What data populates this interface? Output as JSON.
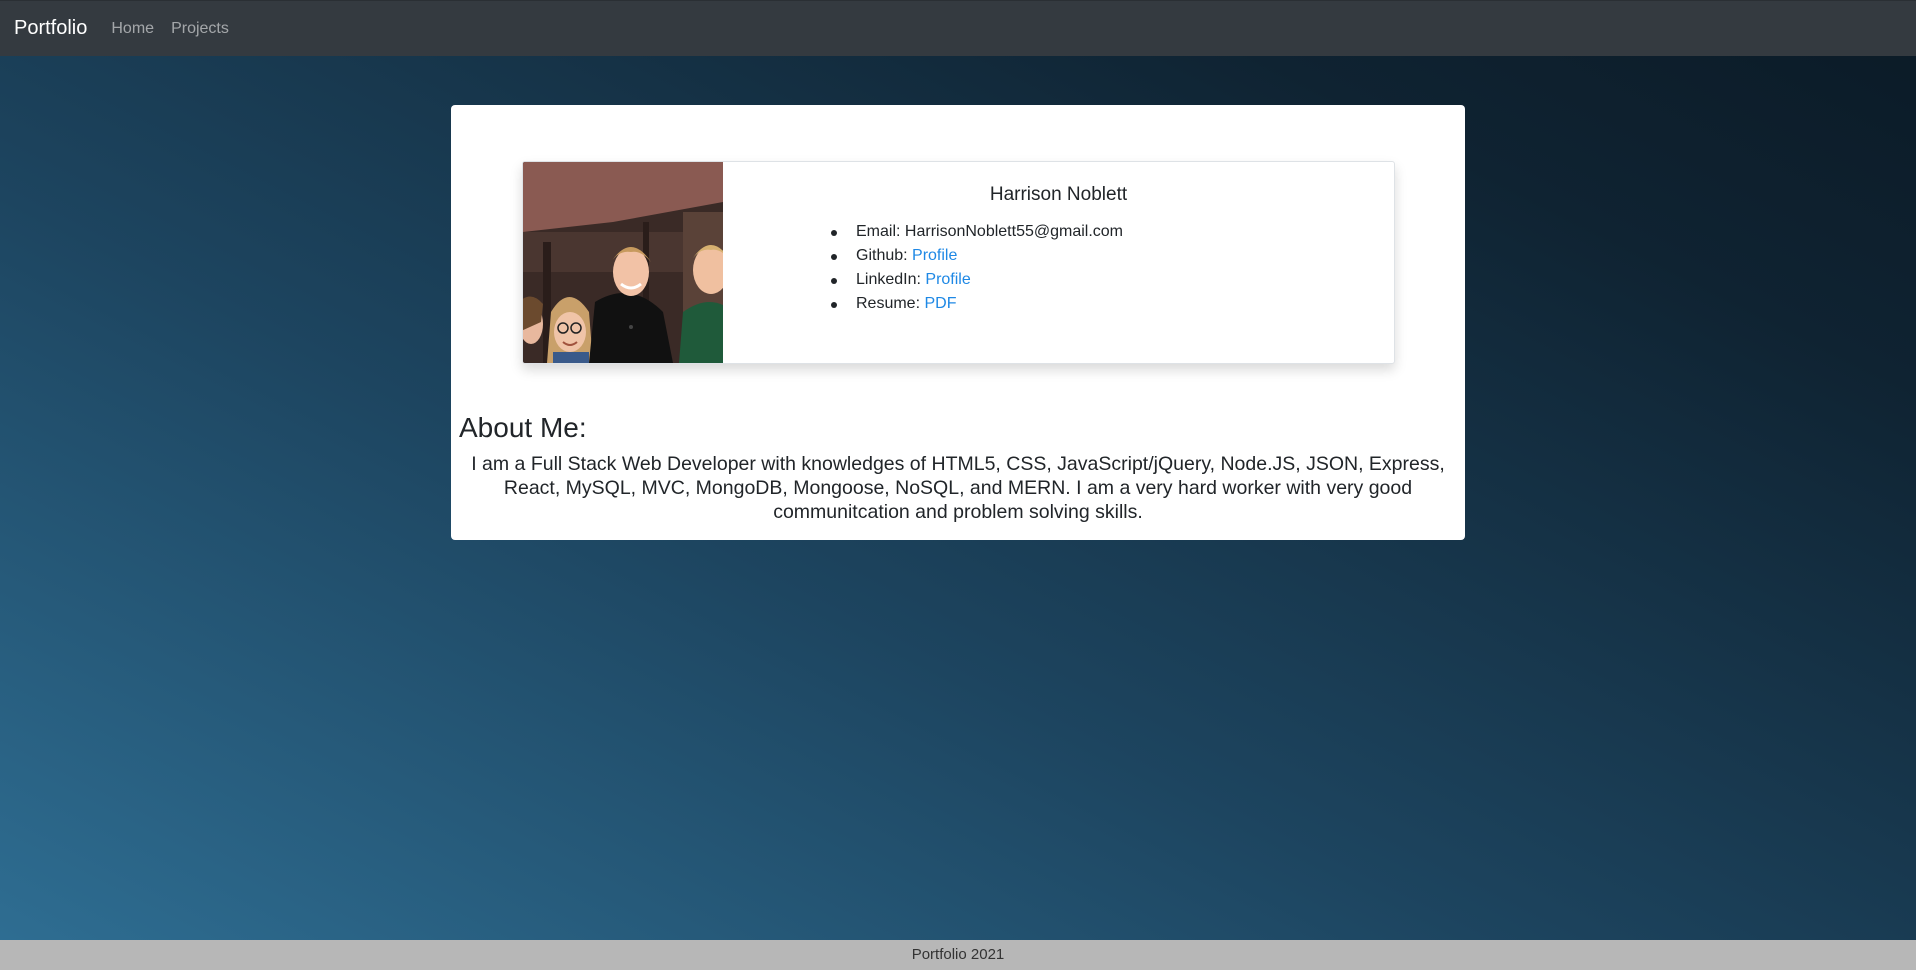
{
  "navbar": {
    "brand": "Portfolio",
    "links": [
      "Home",
      "Projects"
    ]
  },
  "profile": {
    "name": "Harrison Noblett",
    "email_label": "Email: ",
    "email_value": "HarrisonNoblett55@gmail.com",
    "github_label": "Github: ",
    "github_link": "Profile",
    "linkedin_label": "LinkedIn: ",
    "linkedin_link": "Profile",
    "resume_label": "Resume: ",
    "resume_link": "PDF"
  },
  "about": {
    "title": "About Me:",
    "text": "I am a Full Stack Web Developer with knowledges of HTML5, CSS, JavaScript/jQuery, Node.JS, JSON, Express, React, MySQL, MVC, MongoDB, Mongoose, NoSQL, and MERN. I am a very hard worker with very good communitcation and problem solving skills."
  },
  "footer": {
    "text": "Portfolio 2021"
  },
  "colors": {
    "navbar_bg": "#343a40",
    "link": "#1e88e5",
    "footer_bg": "#b7b7b7"
  }
}
